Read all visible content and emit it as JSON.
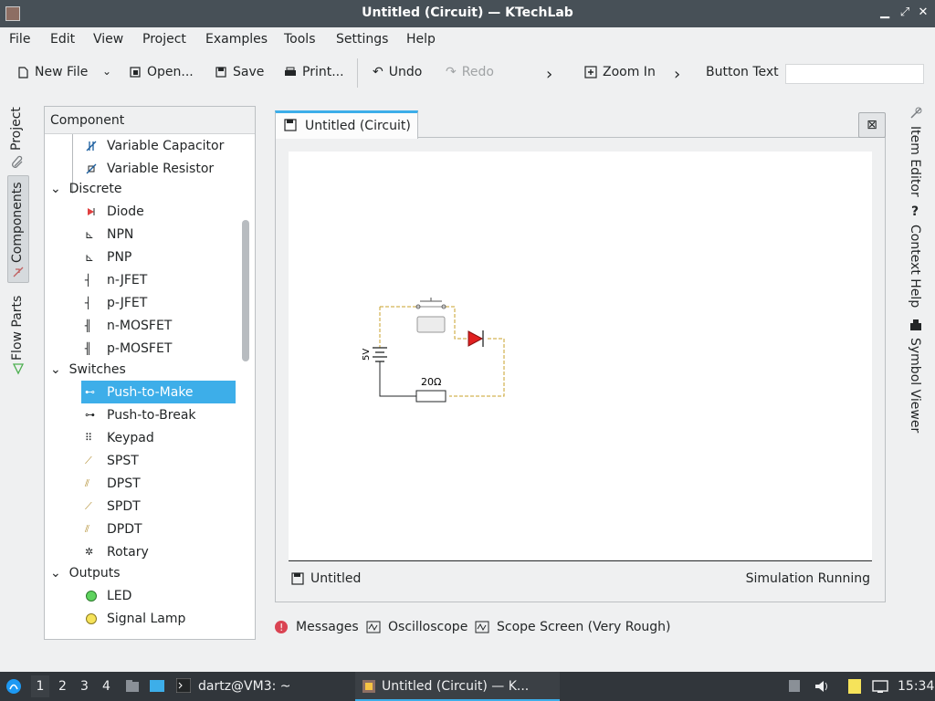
{
  "window": {
    "title": "Untitled (Circuit) — KTechLab"
  },
  "menu": [
    "File",
    "Edit",
    "View",
    "Project",
    "Examples",
    "Tools",
    "Settings",
    "Help"
  ],
  "toolbar": {
    "new_file": "New File",
    "open": "Open...",
    "save": "Save",
    "print": "Print...",
    "undo": "Undo",
    "redo": "Redo",
    "zoom_in": "Zoom In",
    "button_text": "Button Text"
  },
  "left_tabs": {
    "project": "Project",
    "components": "Components",
    "flow_parts": "Flow Parts"
  },
  "component_panel": {
    "header": "Component",
    "items": [
      {
        "label": "Variable Capacitor"
      },
      {
        "label": "Variable Resistor"
      }
    ],
    "categories": {
      "discrete": "Discrete",
      "switches": "Switches",
      "outputs": "Outputs"
    },
    "discrete_items": [
      "Diode",
      "NPN",
      "PNP",
      "n-JFET",
      "p-JFET",
      "n-MOSFET",
      "p-MOSFET"
    ],
    "switch_items": [
      "Push-to-Make",
      "Push-to-Break",
      "Keypad",
      "SPST",
      "DPST",
      "SPDT",
      "DPDT",
      "Rotary"
    ],
    "output_items": [
      "LED",
      "Signal Lamp"
    ]
  },
  "document": {
    "tab_label": "Untitled (Circuit)",
    "status_name": "Untitled",
    "status_sim": "Simulation Running",
    "circuit": {
      "battery_label": "5V",
      "resistor_label": "20Ω"
    }
  },
  "bottom_tabs": {
    "messages": "Messages",
    "oscilloscope": "Oscilloscope",
    "scope_screen": "Scope Screen (Very Rough)"
  },
  "right_tabs": {
    "item_editor": "Item Editor",
    "context_help": "Context Help",
    "symbol_viewer": "Symbol Viewer"
  },
  "taskbar": {
    "workspaces": [
      "1",
      "2",
      "3",
      "4"
    ],
    "terminal": "dartz@VM3: ~",
    "active_window": "Untitled (Circuit) — K...",
    "clock": "15:34"
  },
  "colors": {
    "accent": "#3daee9",
    "taskbar": "#31363b",
    "titlebar": "#475057",
    "wire": "#c8a02a"
  }
}
